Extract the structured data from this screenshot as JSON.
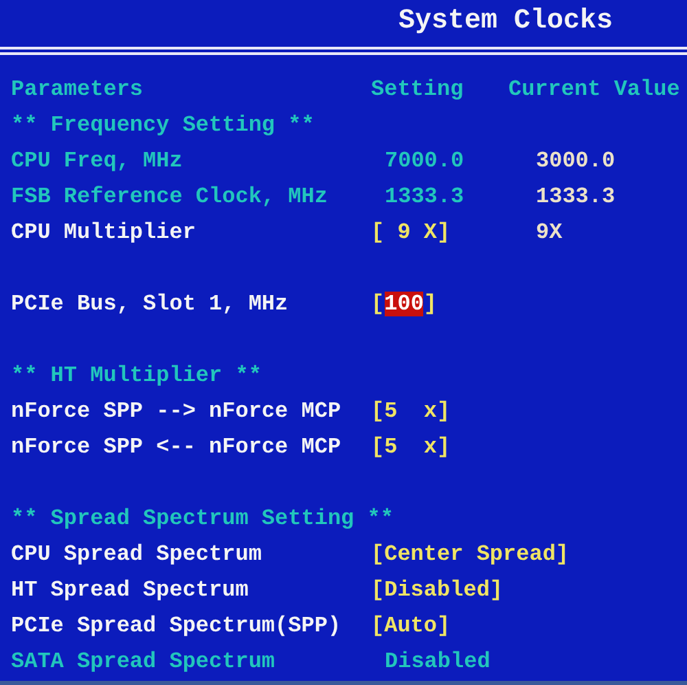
{
  "window": {
    "title": "System Clocks"
  },
  "columns": [
    "Parameters",
    "Setting",
    "Current Value"
  ],
  "rows": [
    {
      "kind": "heading",
      "label": "** Frequency Setting **"
    },
    {
      "kind": "readonly",
      "label": "CPU Freq, MHz",
      "value": "7000.0",
      "current": "3000.0"
    },
    {
      "kind": "readonly",
      "label": "FSB Reference Clock, MHz",
      "value": "1333.3",
      "current": "1333.3"
    },
    {
      "kind": "option",
      "label": "CPU Multiplier",
      "value": "[ 9 X]",
      "current": "9X",
      "selected": false
    },
    {
      "kind": "blank"
    },
    {
      "kind": "option",
      "label": "PCIe Bus, Slot 1, MHz",
      "value": "[100]",
      "selected": true
    },
    {
      "kind": "blank"
    },
    {
      "kind": "heading",
      "label": "** HT Multiplier **"
    },
    {
      "kind": "option",
      "label": "nForce SPP --> nForce MCP",
      "value": "[5  x]",
      "selected": false
    },
    {
      "kind": "option",
      "label": "nForce SPP <-- nForce MCP",
      "value": "[5  x]",
      "selected": false
    },
    {
      "kind": "blank"
    },
    {
      "kind": "heading",
      "label": "** Spread Spectrum Setting **"
    },
    {
      "kind": "option",
      "label": "CPU Spread Spectrum",
      "value": "[Center Spread]",
      "selected": false
    },
    {
      "kind": "option",
      "label": "HT Spread Spectrum",
      "value": "[Disabled]",
      "selected": false
    },
    {
      "kind": "option",
      "label": "PCIe Spread Spectrum(SPP)",
      "value": "[Auto]",
      "selected": false
    },
    {
      "kind": "readonly",
      "label": "SATA Spread Spectrum",
      "value": "Disabled"
    }
  ]
}
